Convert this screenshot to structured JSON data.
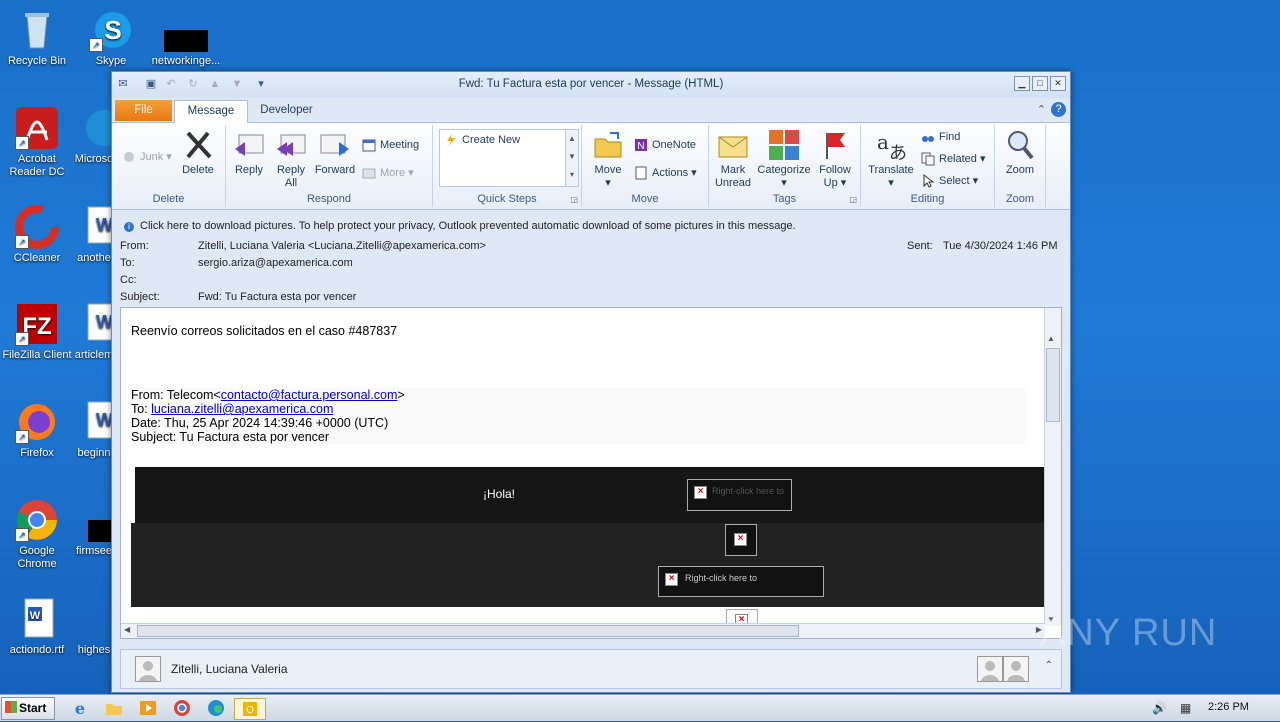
{
  "desktop": {
    "icons": [
      {
        "label": "Recycle Bin",
        "icon": "recycle-bin-icon"
      },
      {
        "label": "Skype",
        "icon": "skype-icon"
      },
      {
        "label": "networkinge...",
        "icon": "file-icon"
      },
      {
        "label": "Acrobat Reader DC",
        "icon": "acrobat-icon"
      },
      {
        "label": "Microso",
        "icon": "edge-icon"
      },
      {
        "label": "CCleaner",
        "icon": "ccleaner-icon"
      },
      {
        "label": "anothe",
        "icon": "word-doc-icon"
      },
      {
        "label": "FileZilla Client",
        "icon": "filezilla-icon"
      },
      {
        "label": "articlem",
        "icon": "word-doc-icon"
      },
      {
        "label": "Firefox",
        "icon": "firefox-icon"
      },
      {
        "label": "beginn",
        "icon": "word-doc-icon"
      },
      {
        "label": "Google Chrome",
        "icon": "chrome-icon"
      },
      {
        "label": "firmsee",
        "icon": "file-icon"
      },
      {
        "label": "actiondo.rtf",
        "icon": "word-doc-icon"
      },
      {
        "label": "highes",
        "icon": "file-icon"
      }
    ]
  },
  "window": {
    "title": "Fwd: Tu Factura esta por vencer  -  Message (HTML)",
    "tabs": [
      "File",
      "Message",
      "Developer"
    ],
    "ribbon": {
      "delete_group": {
        "label": "Delete",
        "junk": "Junk",
        "delete": "Delete"
      },
      "respond_group": {
        "label": "Respond",
        "reply": "Reply",
        "reply_all_1": "Reply",
        "reply_all_2": "All",
        "forward": "Forward",
        "meeting": "Meeting",
        "more": "More"
      },
      "quicksteps_group": {
        "label": "Quick Steps",
        "create_new": "Create New"
      },
      "move_group": {
        "label": "Move",
        "move": "Move",
        "onenote": "OneNote",
        "actions": "Actions"
      },
      "tags_group": {
        "label": "Tags",
        "mark_unread_1": "Mark",
        "mark_unread_2": "Unread",
        "categorize": "Categorize",
        "follow_up_1": "Follow",
        "follow_up_2": "Up"
      },
      "editing_group": {
        "label": "Editing",
        "translate": "Translate",
        "find": "Find",
        "related": "Related",
        "select": "Select"
      },
      "zoom_group": {
        "label": "Zoom",
        "zoom": "Zoom"
      }
    },
    "infobar": "Click here to download pictures. To help protect your privacy, Outlook prevented automatic download of some pictures in this message.",
    "headers": {
      "from_label": "From:",
      "from_value": "Zitelli, Luciana Valeria <Luciana.Zitelli@apexamerica.com>",
      "to_label": "To:",
      "to_value": "sergio.ariza@apexamerica.com",
      "cc_label": "Cc:",
      "subject_label": "Subject:",
      "subject_value": "Fwd: Tu Factura esta por vencer",
      "sent_label": "Sent:",
      "sent_value": "Tue 4/30/2024 1:46 PM"
    },
    "body": {
      "intro": "Reenvío correos solicitados en el caso #487837",
      "fwd_from_prefix": "From: Telecom<",
      "fwd_from_link": "contacto@factura.personal.com",
      "fwd_from_suffix": ">",
      "fwd_to_prefix": "To: ",
      "fwd_to_link": "luciana.zitelli@apexamerica.com",
      "fwd_date": "Date: Thu, 25 Apr 2024 14:39:46 +0000 (UTC)",
      "fwd_subject": "Subject: Tu Factura esta por vencer",
      "banner_greeting": "¡Hola!",
      "broken_image_1": "Right-click here to",
      "broken_image_2": "Right-click here to"
    },
    "people_pane": {
      "name": "Zitelli, Luciana Valeria"
    }
  },
  "taskbar": {
    "start": "Start",
    "clock": "2:26 PM",
    "watermark": "ANY RUN"
  }
}
